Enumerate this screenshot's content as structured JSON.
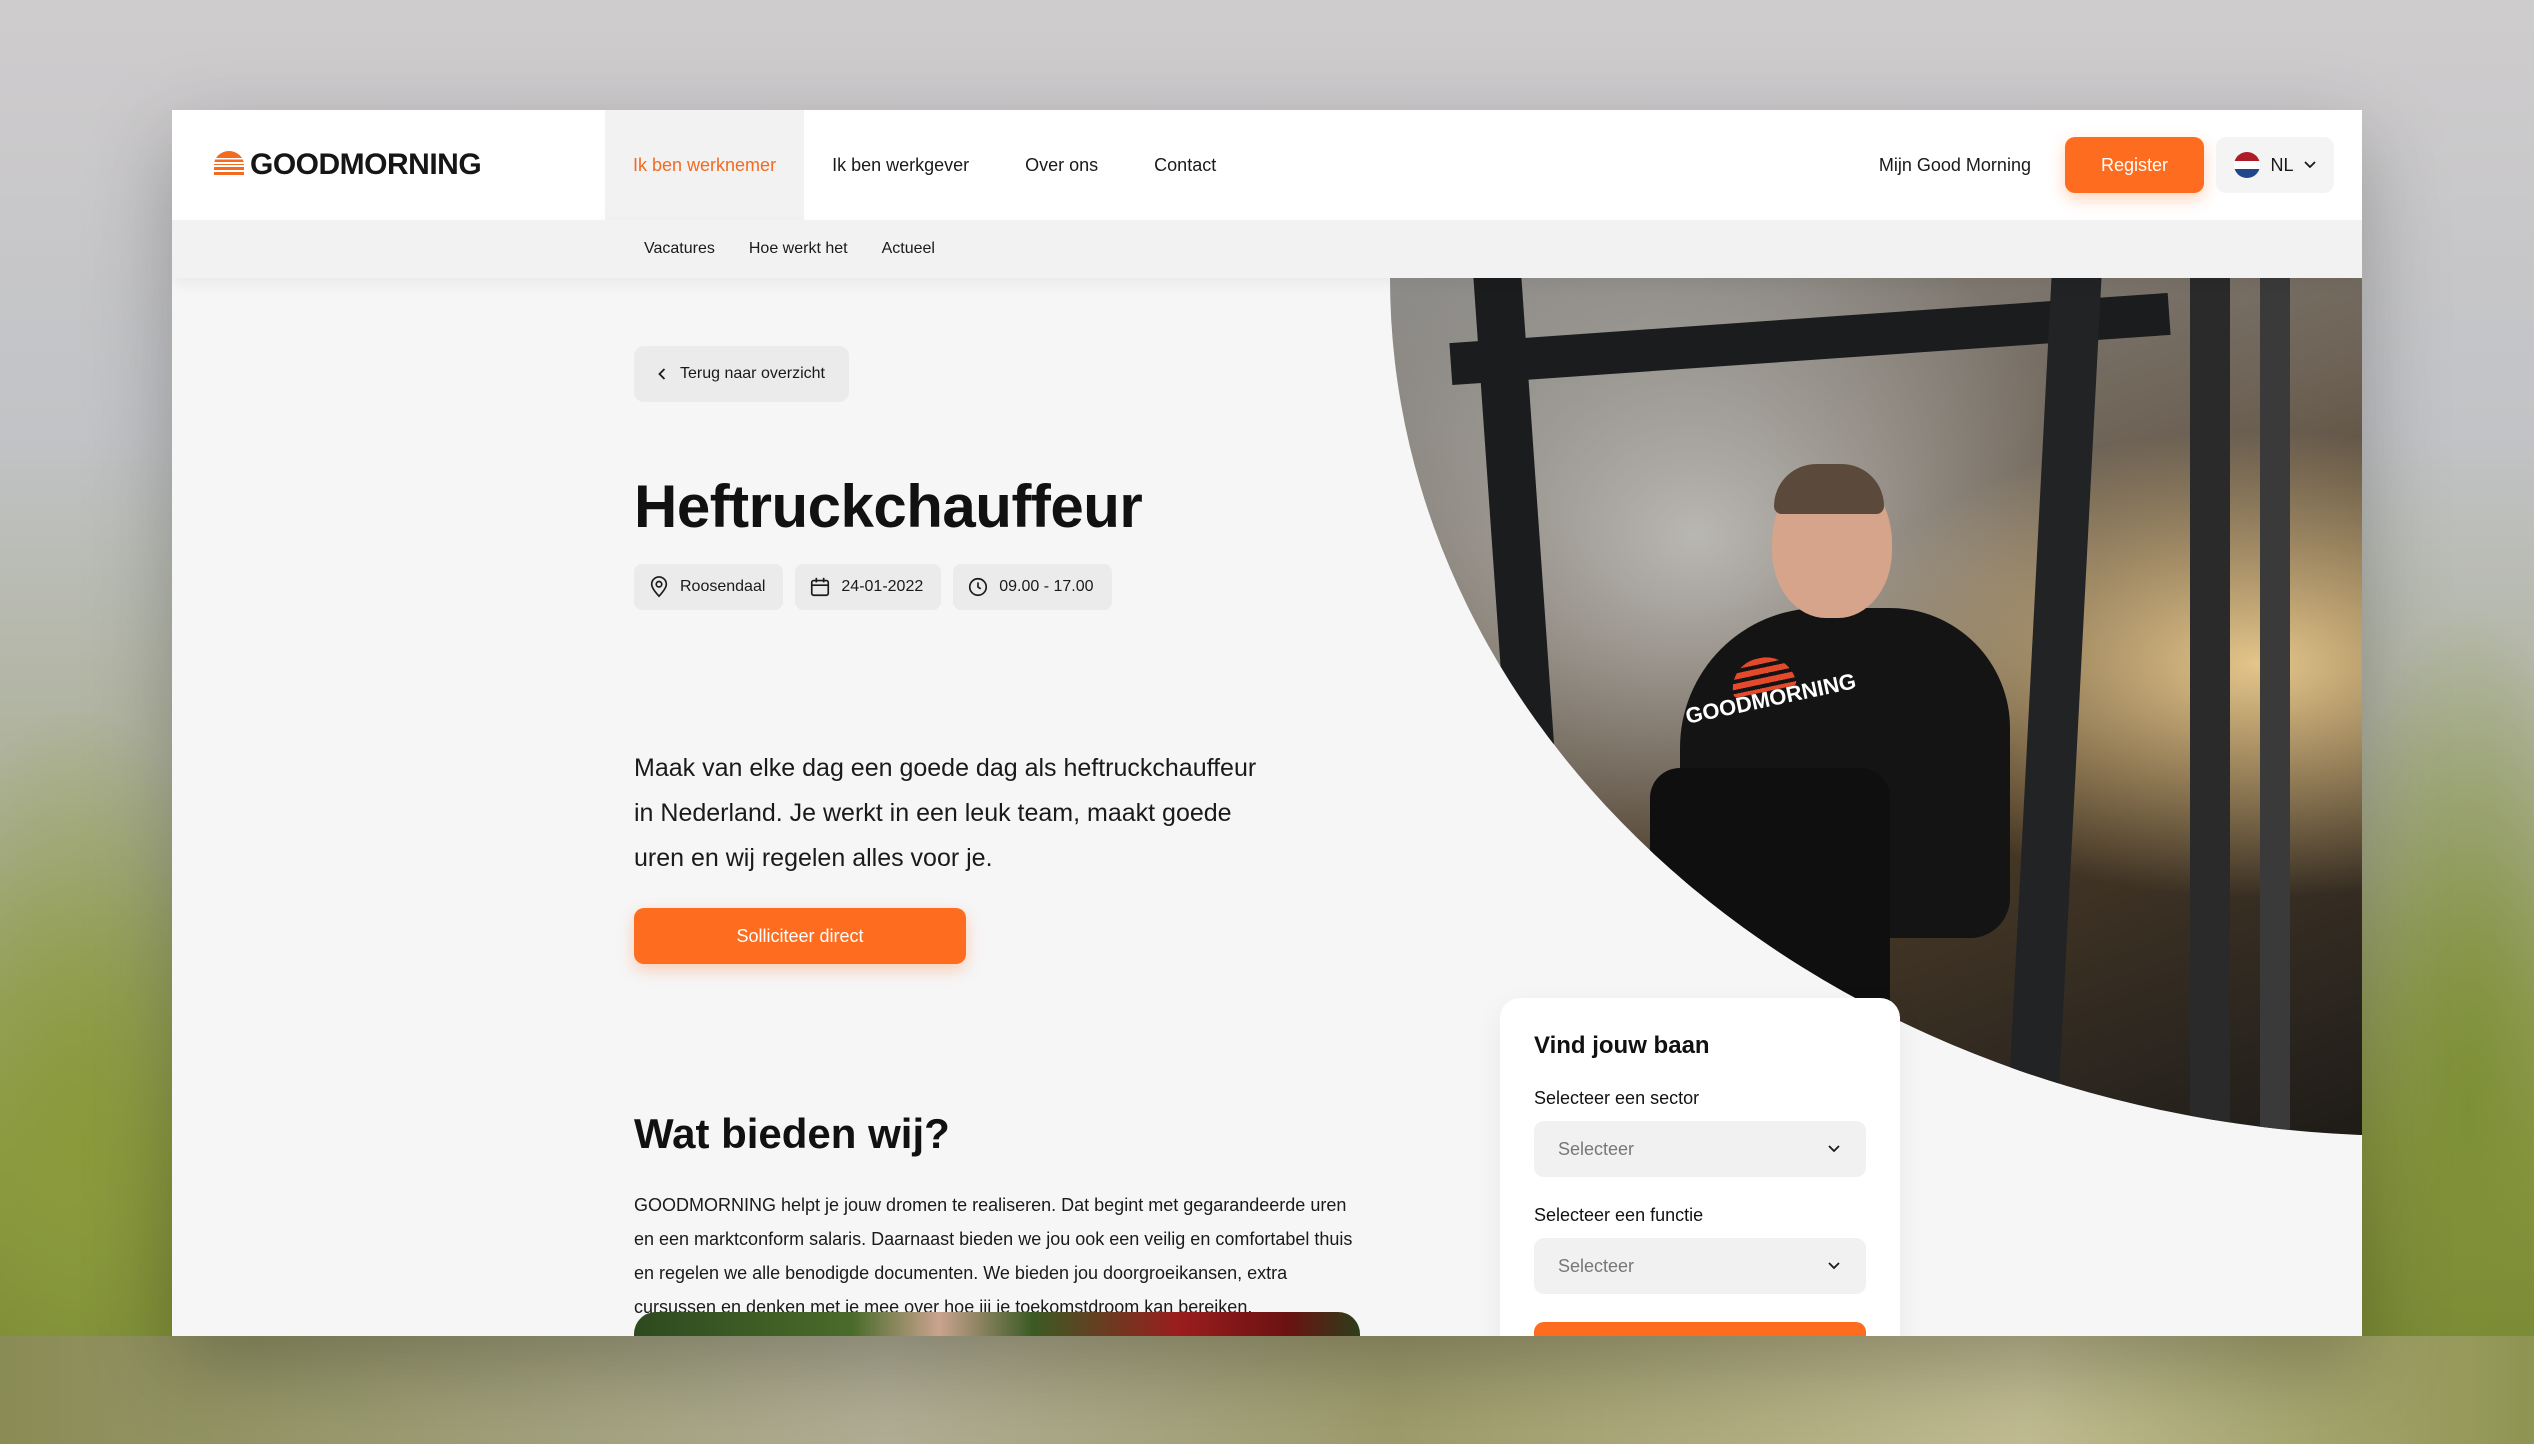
{
  "brand": {
    "name": "GOODMORNING",
    "accent": "#fe6d1f",
    "logo_mark_color": "#e4492b"
  },
  "nav": {
    "items": [
      {
        "label": "Ik ben werknemer",
        "active": true
      },
      {
        "label": "Ik ben werkgever",
        "active": false
      },
      {
        "label": "Over ons",
        "active": false
      },
      {
        "label": "Contact",
        "active": false
      }
    ],
    "account_link": "Mijn Good Morning",
    "register_label": "Register",
    "language": "NL"
  },
  "subnav": {
    "items": [
      "Vacatures",
      "Hoe werkt het",
      "Actueel"
    ]
  },
  "job": {
    "back_label": "Terug naar overzicht",
    "title": "Heftruckchauffeur",
    "location": "Roosendaal",
    "date": "24-01-2022",
    "hours": "09.00 - 17.00",
    "intro": "Maak van elke dag een goede dag als heftruckchauffeur in Nederland. Je werkt in een leuk team, maakt goede uren en wij regelen alles voor je.",
    "apply_label": "Solliciteer direct"
  },
  "offer": {
    "title": "Wat bieden wij?",
    "body": "GOODMORNING helpt je jouw dromen te realiseren. Dat begint met gegarandeerde uren en een marktconform salaris. Daarnaast bieden we jou ook een veilig en comfortabel thuis en regelen we alle benodigde documenten. We bieden jou doorgroeikansen, extra cursussen en denken met je mee over hoe jij je toekomstdroom kan bereiken."
  },
  "find_job": {
    "title": "Vind jouw baan",
    "sector_label": "Selecteer een sector",
    "sector_placeholder": "Selecteer",
    "function_label": "Selecteer een functie",
    "function_placeholder": "Selecteer"
  },
  "hero_photo": {
    "shirt_text": "GOODMORNING"
  },
  "icons": {
    "location": "map-pin-icon",
    "date": "calendar-icon",
    "hours": "clock-icon",
    "back": "chevron-left-icon",
    "dropdown": "chevron-down-icon"
  }
}
